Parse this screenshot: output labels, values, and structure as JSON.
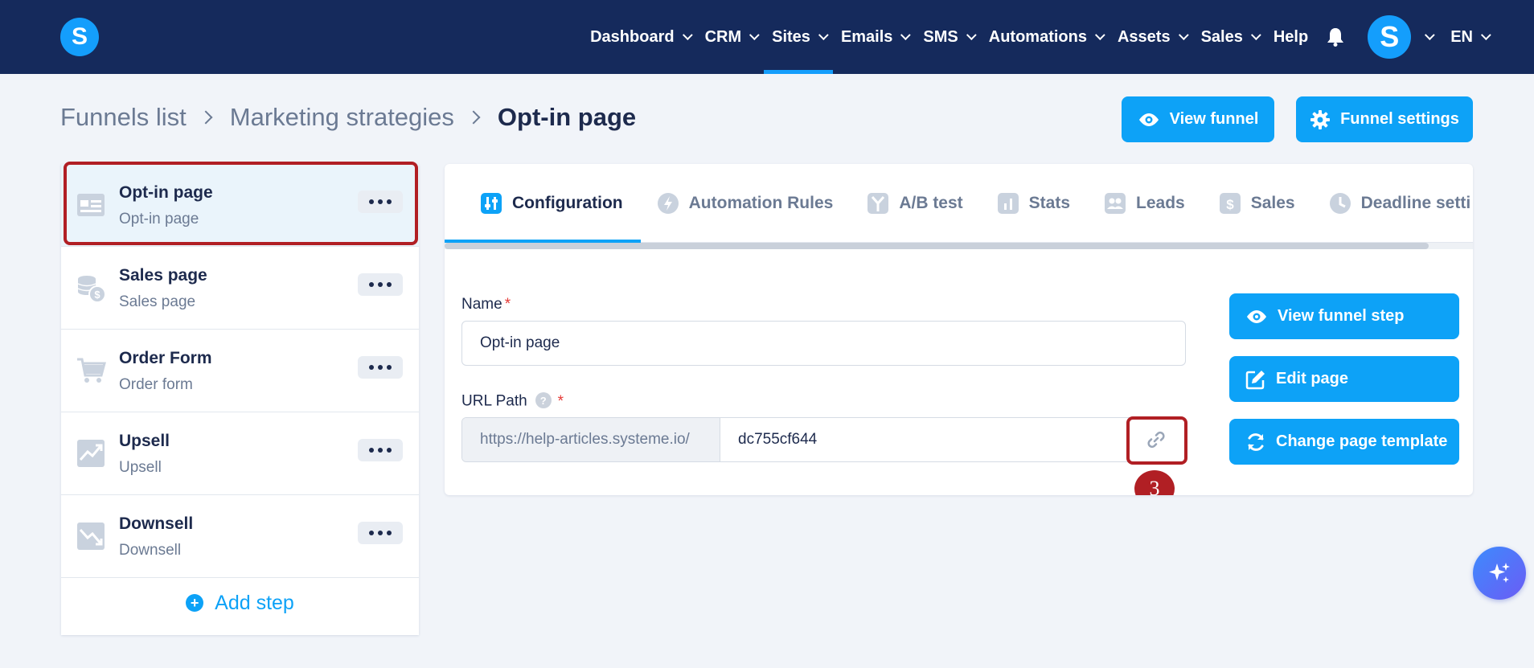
{
  "nav": {
    "logo": "S",
    "items": [
      {
        "label": "Dashboard",
        "active": false
      },
      {
        "label": "CRM",
        "active": false
      },
      {
        "label": "Sites",
        "active": true
      },
      {
        "label": "Emails",
        "active": false
      },
      {
        "label": "SMS",
        "active": false
      },
      {
        "label": "Automations",
        "active": false
      },
      {
        "label": "Assets",
        "active": false
      },
      {
        "label": "Sales",
        "active": false
      }
    ],
    "help": "Help",
    "avatar": "S",
    "lang": "EN"
  },
  "breadcrumb": {
    "items": [
      "Funnels list",
      "Marketing strategies",
      "Opt-in page"
    ]
  },
  "header_buttons": {
    "view_funnel": "View funnel",
    "funnel_settings": "Funnel settings"
  },
  "steps": {
    "items": [
      {
        "title": "Opt-in page",
        "subtitle": "Opt-in page",
        "icon": "optin-page-icon"
      },
      {
        "title": "Sales page",
        "subtitle": "Sales page",
        "icon": "coins-icon"
      },
      {
        "title": "Order Form",
        "subtitle": "Order form",
        "icon": "cart-icon"
      },
      {
        "title": "Upsell",
        "subtitle": "Upsell",
        "icon": "trend-up-icon"
      },
      {
        "title": "Downsell",
        "subtitle": "Downsell",
        "icon": "trend-down-icon"
      }
    ],
    "add_step": "Add step"
  },
  "tabs": [
    {
      "label": "Configuration",
      "icon": "sliders-icon"
    },
    {
      "label": "Automation Rules",
      "icon": "bolt-icon"
    },
    {
      "label": "A/B test",
      "icon": "split-icon"
    },
    {
      "label": "Stats",
      "icon": "bar-chart-icon"
    },
    {
      "label": "Leads",
      "icon": "users-icon"
    },
    {
      "label": "Sales",
      "icon": "dollar-icon"
    },
    {
      "label": "Deadline setti",
      "icon": "clock-icon"
    }
  ],
  "form": {
    "name_label": "Name",
    "required_mark": "*",
    "name_value": "Opt-in page",
    "url_label": "URL Path",
    "help_mark": "?",
    "url_prefix": "https://help-articles.systeme.io/",
    "url_slug": "dc755cf644"
  },
  "side_buttons": {
    "view_step": "View funnel step",
    "edit_page": "Edit page",
    "change_template": "Change page template"
  },
  "annotation": {
    "badge": "3",
    "color": "#b11f24"
  },
  "colors": {
    "nav_bg": "#152a5c",
    "accent": "#0da2f7",
    "page_bg": "#f1f4f9"
  }
}
